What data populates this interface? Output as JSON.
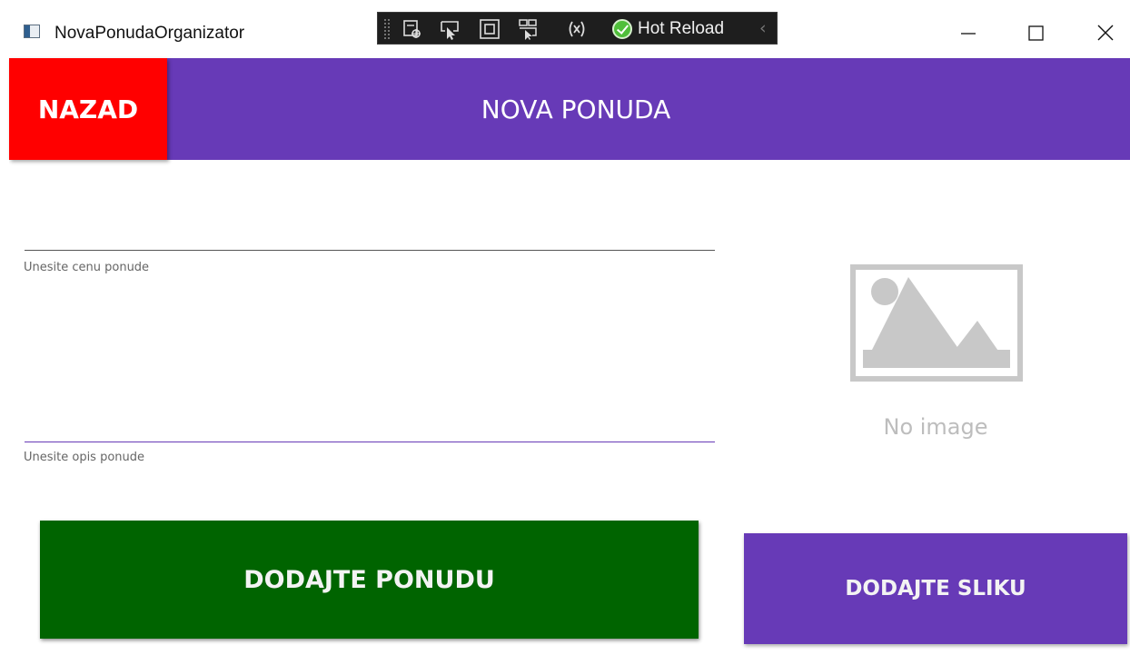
{
  "window": {
    "title": "NovaPonudaOrganizator"
  },
  "devtools": {
    "hot_reload_label": "Hot Reload",
    "icons": [
      "select-element-icon",
      "display-layout-adorners-icon",
      "track-focused-element-icon",
      "live-visual-tree-icon",
      "binding-failures-icon",
      "hot-reload-status-icon"
    ]
  },
  "header": {
    "back_label": "NAZAD",
    "title": "NOVA PONUDA"
  },
  "form": {
    "price": {
      "value": "",
      "helper": "Unesite cenu ponude"
    },
    "description": {
      "value": "",
      "helper": "Unesite opis ponude"
    },
    "submit_label": "DODAJTE PONUDU"
  },
  "image": {
    "placeholder_text": "No image",
    "add_label": "DODAJTE SLIKU"
  },
  "colors": {
    "accent": "#673ab7",
    "back_button": "#ff0000",
    "submit_button": "#006400",
    "placeholder_gray": "#c8c8c8"
  }
}
